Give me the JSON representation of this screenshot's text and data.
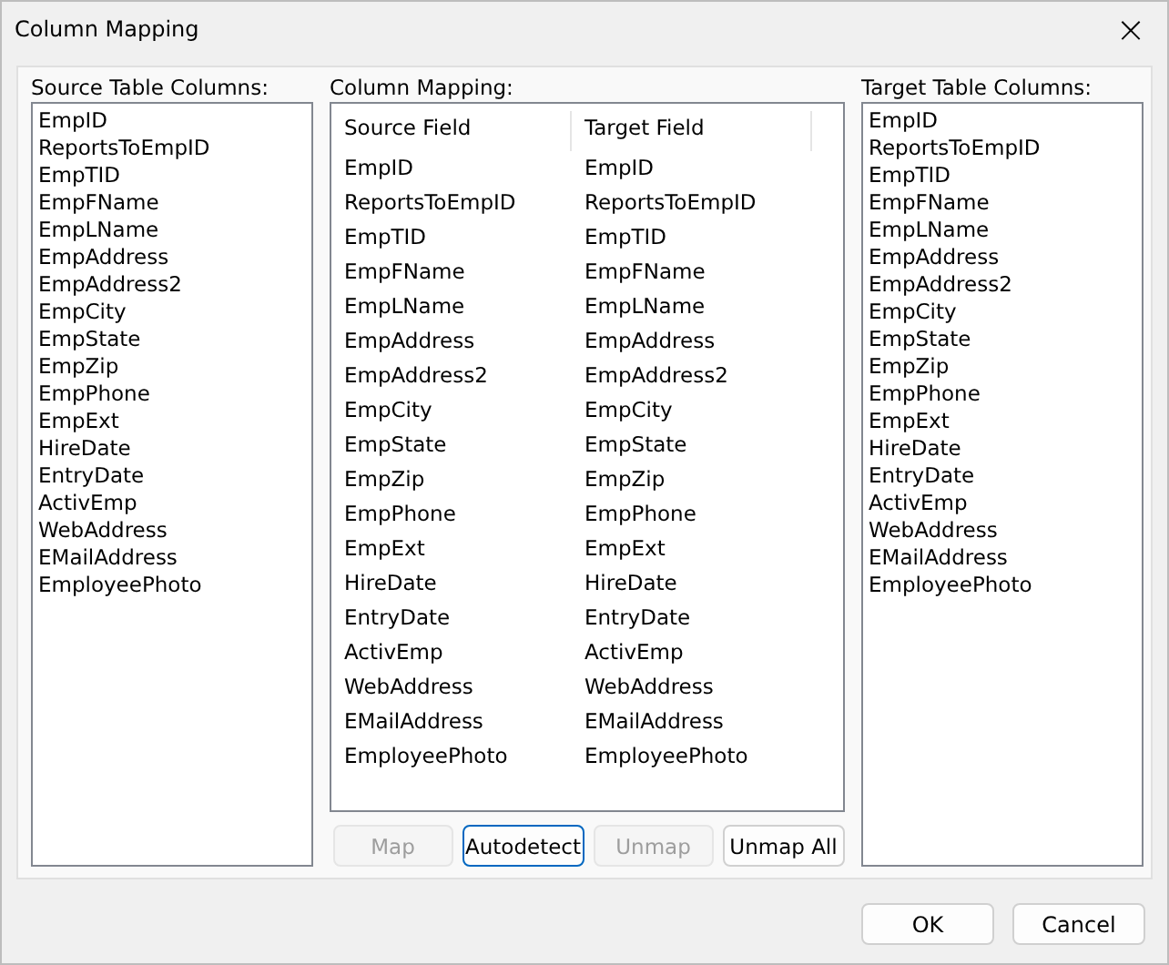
{
  "window": {
    "title": "Column Mapping",
    "close": "×"
  },
  "source_columns": {
    "label": "Source Table Columns:",
    "items": [
      "EmpID",
      "ReportsToEmpID",
      "EmpTID",
      "EmpFName",
      "EmpLName",
      "EmpAddress",
      "EmpAddress2",
      "EmpCity",
      "EmpState",
      "EmpZip",
      "EmpPhone",
      "EmpExt",
      "HireDate",
      "EntryDate",
      "ActivEmp",
      "WebAddress",
      "EMailAddress",
      "EmployeePhoto"
    ]
  },
  "mapping": {
    "label": "Column Mapping:",
    "columns": [
      "Source Field",
      "Target Field"
    ],
    "rows": [
      [
        "EmpID",
        "EmpID"
      ],
      [
        "ReportsToEmpID",
        "ReportsToEmpID"
      ],
      [
        "EmpTID",
        "EmpTID"
      ],
      [
        "EmpFName",
        "EmpFName"
      ],
      [
        "EmpLName",
        "EmpLName"
      ],
      [
        "EmpAddress",
        "EmpAddress"
      ],
      [
        "EmpAddress2",
        "EmpAddress2"
      ],
      [
        "EmpCity",
        "EmpCity"
      ],
      [
        "EmpState",
        "EmpState"
      ],
      [
        "EmpZip",
        "EmpZip"
      ],
      [
        "EmpPhone",
        "EmpPhone"
      ],
      [
        "EmpExt",
        "EmpExt"
      ],
      [
        "HireDate",
        "HireDate"
      ],
      [
        "EntryDate",
        "EntryDate"
      ],
      [
        "ActivEmp",
        "ActivEmp"
      ],
      [
        "WebAddress",
        "WebAddress"
      ],
      [
        "EMailAddress",
        "EMailAddress"
      ],
      [
        "EmployeePhoto",
        "EmployeePhoto"
      ]
    ],
    "buttons": [
      {
        "label": "Map",
        "disabled": true,
        "focused": false
      },
      {
        "label": "Autodetect",
        "disabled": false,
        "focused": true
      },
      {
        "label": "Unmap",
        "disabled": true,
        "focused": false
      },
      {
        "label": "Unmap All",
        "disabled": false,
        "focused": false
      }
    ]
  },
  "target_columns": {
    "label": "Target Table Columns:",
    "items": [
      "EmpID",
      "ReportsToEmpID",
      "EmpTID",
      "EmpFName",
      "EmpLName",
      "EmpAddress",
      "EmpAddress2",
      "EmpCity",
      "EmpState",
      "EmpZip",
      "EmpPhone",
      "EmpExt",
      "HireDate",
      "EntryDate",
      "ActivEmp",
      "WebAddress",
      "EMailAddress",
      "EmployeePhoto"
    ]
  },
  "footer_buttons": [
    "OK",
    "Cancel"
  ]
}
